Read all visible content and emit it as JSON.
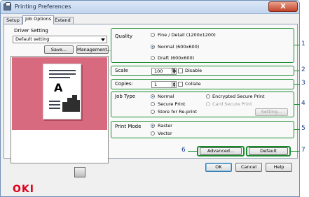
{
  "window": {
    "title": "Printing Preferences",
    "close_glyph": "X"
  },
  "tabs": [
    {
      "label": "Setup",
      "active": false
    },
    {
      "label": "Job Options",
      "active": true
    },
    {
      "label": "Extend",
      "active": false
    }
  ],
  "driver_setting": {
    "label": "Driver Setting",
    "value": "Default setting",
    "save_label": "Save...",
    "management_label": "Management..."
  },
  "preview": {
    "doc_letter": "A",
    "bars": [
      14,
      20,
      24,
      17
    ],
    "top_color": "#d86a80"
  },
  "brand": {
    "logo_text": "OKI",
    "color": "#e0001b"
  },
  "quality": {
    "label": "Quality",
    "options": [
      {
        "label": "Fine / Detail (1200x1200)",
        "selected": false
      },
      {
        "label": "Normal (600x600)",
        "selected": true
      },
      {
        "label": "Draft (600x600)",
        "selected": false
      }
    ]
  },
  "scale": {
    "label": "Scale",
    "value": "100",
    "unit": "%",
    "checkbox_label": "Disable",
    "checked": false
  },
  "copies": {
    "label": "Copies:",
    "value": "1",
    "checkbox_label": "Collate",
    "checked": false
  },
  "job_type": {
    "label": "Job Type",
    "options": [
      {
        "label": "Normal",
        "selected": true,
        "enabled": true
      },
      {
        "label": "Encrypted Secure Print",
        "selected": false,
        "enabled": true
      },
      {
        "label": "Secure Print",
        "selected": false,
        "enabled": true
      },
      {
        "label": "Card Secure Print",
        "selected": false,
        "enabled": false
      },
      {
        "label": "Store for Re-print",
        "selected": false,
        "enabled": true
      }
    ],
    "setting_label": "Setting..."
  },
  "print_mode": {
    "label": "Print Mode",
    "options": [
      {
        "label": "Raster",
        "selected": true
      },
      {
        "label": "Vector",
        "selected": false
      }
    ]
  },
  "buttons": {
    "advanced": "Advanced...",
    "default": "Default",
    "ok": "OK",
    "cancel": "Cancel",
    "help": "Help"
  },
  "callouts": [
    "1",
    "2",
    "3",
    "4",
    "5",
    "6",
    "7"
  ],
  "colors": {
    "highlight": "#1a8c2e",
    "callout_text": "#1a3c8c",
    "accent": "#3c7fb1"
  }
}
